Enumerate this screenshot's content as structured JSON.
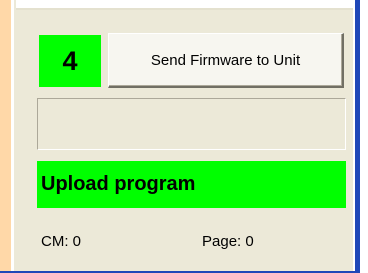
{
  "panel": {
    "step_number": "4",
    "send_button_label": "Send Firmware to Unit",
    "status_text": "Upload program",
    "cm_text": "CM: 0",
    "page_text": "Page: 0"
  },
  "colors": {
    "highlight": "#00ff00",
    "panel_background": "#ece9d8",
    "window_border": "#1f47b8"
  }
}
